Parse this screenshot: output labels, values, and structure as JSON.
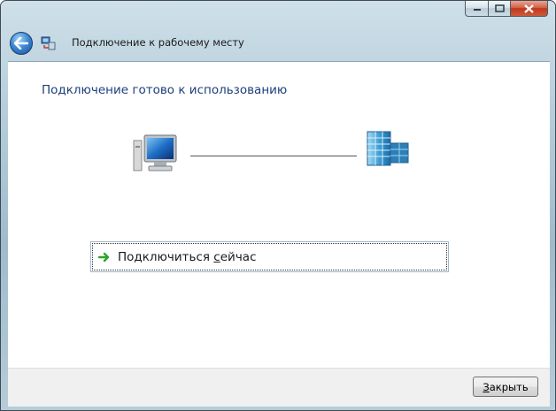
{
  "window": {
    "title": "Подключение к рабочему месту",
    "caption_buttons": [
      "minimize",
      "maximize",
      "close"
    ]
  },
  "content": {
    "heading": "Подключение готово к использованию",
    "connect_option": {
      "label_prefix": "Подключиться ",
      "label_accel": "с",
      "label_suffix": "ейчас",
      "icon": "green-arrow-icon"
    }
  },
  "footer": {
    "close_accel": "З",
    "close_rest": "акрыть"
  },
  "icons": {
    "back": "back-arrow-icon",
    "wizard": "network-wizard-icon",
    "computer": "computer-icon",
    "server": "workplace-server-icon"
  },
  "colors": {
    "heading": "#1d3e7a",
    "arrow": "#2aa52a",
    "close_caption": "#c0381a"
  }
}
